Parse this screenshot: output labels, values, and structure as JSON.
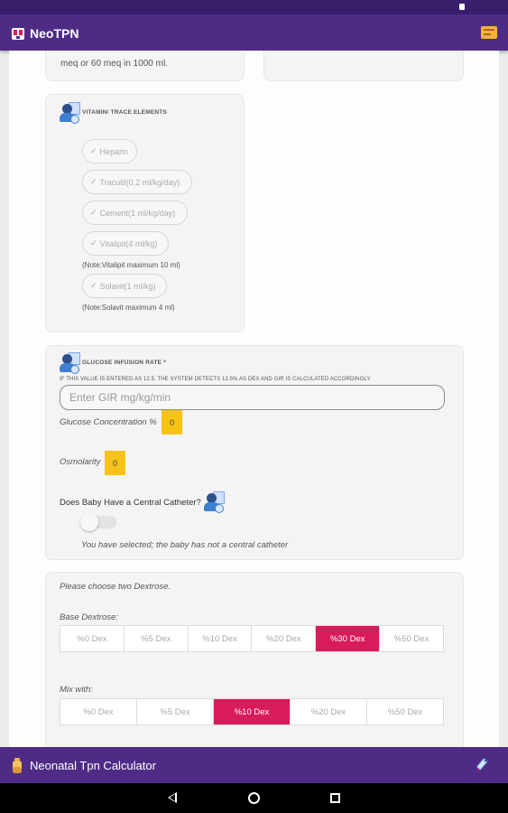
{
  "app": {
    "title": "NeoTPN"
  },
  "top_card": {
    "text": "meq or 60 meq in 1000 ml."
  },
  "vitamin": {
    "title": "VITAMIN/ TRACE ELEMENTS",
    "items": [
      {
        "label": "Heparin"
      },
      {
        "label": "Tracutil(0.2 ml/kg/day)"
      },
      {
        "label": "Cement(1 ml/kg/day)"
      },
      {
        "label": "Vitalipit(4 ml/kg)"
      },
      {
        "label": "Solavit(1 ml/kg)"
      }
    ],
    "note_vitalipit": "(Note:Vitalipit maximum 10 ml)",
    "note_solavit": "(Note:Solavit maximum 4 ml)"
  },
  "gir": {
    "title": "GLUCOSE INFUSION RATE *",
    "subtitle": "IF THIS VALUE IS ENTERED AS 12.5, THE SYSTEM DETECTS 12.5% AS DEX AND GIR IS CALCULATED ACCORDINGLY.",
    "placeholder": "Enter GIR mg/kg/min",
    "glucose_label": "Glucose Concentration %",
    "glucose_value": "0",
    "osmolarity_label": "Osmolarity",
    "osmolarity_value": "0",
    "catheter_question": "Does Baby Have a Central Catheter?",
    "catheter_selected": "You have selected; the baby has not a central catheter"
  },
  "dextrose": {
    "instruction": "Please choose two Dextrose.",
    "base_label": "Base Dextrose:",
    "base_options": [
      "%0 Dex",
      "%5 Dex",
      "%10 Dex",
      "%20 Dex",
      "%30 Dex",
      "%50 Dex"
    ],
    "base_selected": 4,
    "mix_label": "Mix with:",
    "mix_options": [
      "%0 Dex",
      "%5 Dex",
      "%10 Dex",
      "%20 Dex",
      "%50 Dex"
    ],
    "mix_selected": 2
  },
  "footer": {
    "title": "Neonatal Tpn Calculator"
  },
  "colors": {
    "primary": "#4e2c86",
    "accent": "#d81b5a",
    "highlight": "#f7c315"
  }
}
